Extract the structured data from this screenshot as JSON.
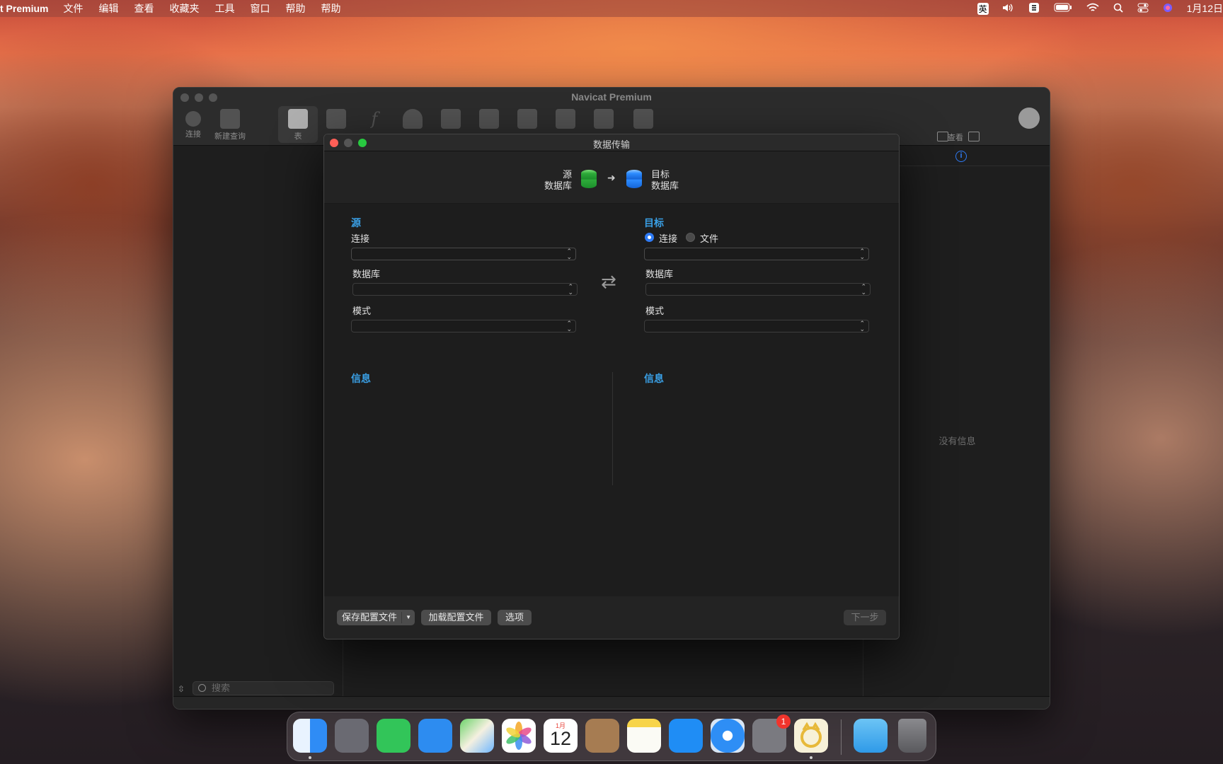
{
  "menubar": {
    "app_name": "t Premium",
    "menus": [
      "文件",
      "编辑",
      "查看",
      "收藏夹",
      "工具",
      "窗口",
      "帮助",
      "帮助"
    ],
    "input_method": "英",
    "clock": "1月12日"
  },
  "window": {
    "title": "Navicat Premium",
    "toolbar": {
      "connect_label": "连接",
      "new_query_label": "新建查询",
      "table_label": "表",
      "view_label": "查看"
    },
    "sidebar": {
      "search_placeholder": "搜索"
    },
    "right_panel": {
      "no_info": "没有信息"
    }
  },
  "dialog": {
    "title": "数据传输",
    "header": {
      "source_line1": "源",
      "source_line2": "数据库",
      "target_line1": "目标",
      "target_line2": "数据库",
      "arrow": "➜"
    },
    "source": {
      "section_title": "源",
      "connection_label": "连接",
      "database_label": "数据库",
      "schema_label": "模式",
      "info_title": "信息"
    },
    "target": {
      "section_title": "目标",
      "radio_connection": "连接",
      "radio_file": "文件",
      "selected_mode": "连接",
      "database_label": "数据库",
      "schema_label": "模式",
      "info_title": "信息"
    },
    "swap_symbol": "⇄",
    "footer": {
      "save_profile": "保存配置文件",
      "load_profile": "加载配置文件",
      "options": "选项",
      "next": "下一步"
    }
  },
  "dock": {
    "calendar_month": "1月",
    "calendar_day": "12",
    "settings_badge": "1"
  },
  "colors": {
    "accent_blue": "#2f7bf5",
    "section_title": "#3aa0e6",
    "close": "#ff5f57",
    "minimize": "#febc2e",
    "zoom": "#28c840"
  }
}
